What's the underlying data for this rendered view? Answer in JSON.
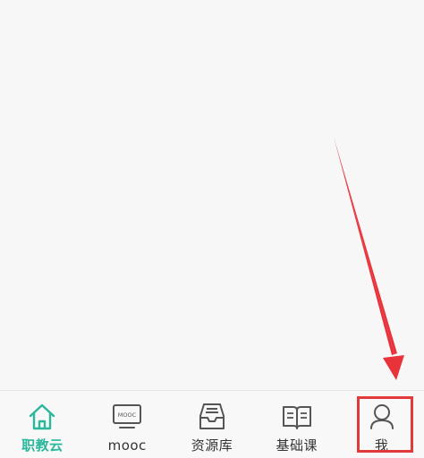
{
  "tabbar": {
    "tabs": [
      {
        "id": "home",
        "label": "职教云",
        "icon": "home-icon",
        "active": true
      },
      {
        "id": "mooc",
        "label": "mooc",
        "icon": "mooc-monitor-icon",
        "icon_text": "MOOC",
        "active": false
      },
      {
        "id": "resources",
        "label": "资源库",
        "icon": "inbox-icon",
        "active": false
      },
      {
        "id": "courses",
        "label": "基础课",
        "icon": "book-icon",
        "active": false
      },
      {
        "id": "me",
        "label": "我",
        "icon": "user-icon",
        "active": false
      }
    ]
  },
  "annotation": {
    "highlight_color": "#e03a3a",
    "arrow_color": "#e8333a"
  },
  "colors": {
    "accent": "#2bb79b",
    "icon_gray": "#555555",
    "text": "#333333",
    "background": "#f7f7f7"
  }
}
